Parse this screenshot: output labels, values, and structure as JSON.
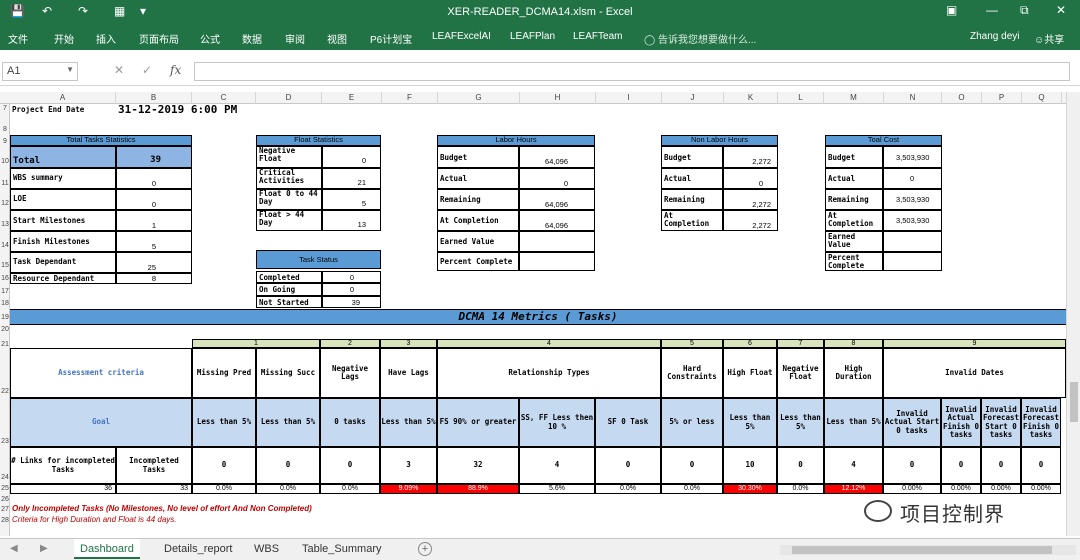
{
  "window": {
    "title": "XER-READER_DCMA14.xlsm - Excel",
    "qa_icons": [
      "save-icon",
      "undo-icon",
      "redo-icon",
      "form-icon",
      "customize-icon"
    ],
    "win_icons": [
      "ribbon-display-icon",
      "minimize-icon",
      "restore-icon",
      "close-icon"
    ]
  },
  "ribbon": {
    "tabs": [
      "文件",
      "开始",
      "插入",
      "页面布局",
      "公式",
      "数据",
      "审阅",
      "视图",
      "P6计划宝",
      "LEAFExcelAI",
      "LEAFPlan",
      "LEAFTeam"
    ],
    "tell_me": "告诉我您想要做什么...",
    "user": "Zhang deyi",
    "share": "共享"
  },
  "formula_bar": {
    "name_box": "A1",
    "cancel": "✕",
    "enter": "✓",
    "fx": "fx",
    "formula": ""
  },
  "columns": [
    "A",
    "B",
    "C",
    "D",
    "E",
    "F",
    "G",
    "H",
    "I",
    "J",
    "K",
    "L",
    "M",
    "N",
    "O",
    "P",
    "Q"
  ],
  "rows": [
    "7",
    "8",
    "9",
    "10",
    "11",
    "12",
    "13",
    "14",
    "15",
    "16",
    "17",
    "18",
    "19",
    "20",
    "21",
    "22",
    "23",
    "24",
    "25",
    "26",
    "27",
    "28"
  ],
  "project_end": {
    "label": "Project End Date",
    "value": "31-12-2019 6:00 PM"
  },
  "total_tasks": {
    "header": "Total Tasks Statistics",
    "total_label": "Total",
    "total_value": "39",
    "rows": [
      {
        "label": "WBS summary",
        "value": "0"
      },
      {
        "label": "LOE",
        "value": "0"
      },
      {
        "label": "Start Milestones",
        "value": "1"
      },
      {
        "label": "Finish Milestones",
        "value": "5"
      },
      {
        "label": "Task Dependant",
        "value": "25"
      },
      {
        "label": "Resource Dependant",
        "value": "8"
      }
    ]
  },
  "float_stats": {
    "header": "Float Statistics",
    "rows": [
      {
        "label": "Negative Float",
        "value": "0"
      },
      {
        "label": "Critical Activities",
        "value": "21"
      },
      {
        "label": "Float 0 to 44 Day",
        "value": "5"
      },
      {
        "label": "Float > 44 Day",
        "value": "13"
      }
    ]
  },
  "task_status": {
    "header": "Task Status",
    "rows": [
      {
        "label": "Completed",
        "value": "0"
      },
      {
        "label": "On Going",
        "value": "0"
      },
      {
        "label": "Not Started",
        "value": "39"
      }
    ]
  },
  "labor": {
    "header": "Labor Hours",
    "rows": [
      {
        "label": "Budget",
        "value": "64,096"
      },
      {
        "label": "Actual",
        "value": "0"
      },
      {
        "label": "Remaining",
        "value": "64,096"
      },
      {
        "label": "At Completion",
        "value": "64,096"
      },
      {
        "label": "Earned Value",
        "value": ""
      },
      {
        "label": "Percent Complete",
        "value": ""
      }
    ]
  },
  "nonlabor": {
    "header": "Non Labor Hours",
    "rows": [
      {
        "label": "Budget",
        "value": "2,272"
      },
      {
        "label": "Actual",
        "value": "0"
      },
      {
        "label": "Remaining",
        "value": "2,272"
      },
      {
        "label": "At Completion",
        "value": "2,272"
      }
    ]
  },
  "cost": {
    "header": "Toal Cost",
    "rows": [
      {
        "label": "Budget",
        "value": "3,503,930"
      },
      {
        "label": "Actual",
        "value": "0"
      },
      {
        "label": "Remaining",
        "value": "3,503,930"
      },
      {
        "label": "At Completion",
        "value": "3,503,930"
      },
      {
        "label": "Earned Value",
        "value": ""
      },
      {
        "label": "Percent Complete",
        "value": ""
      }
    ]
  },
  "dcma": {
    "title": "DCMA 14 Metrics ( Tasks)",
    "assessment_label": "Assessment criteria",
    "goal_label": "Goal",
    "links_label": "# Links for incompleted Tasks",
    "incompleted_label": "Incompleted Tasks",
    "links_value": "36",
    "incompleted_value": "33",
    "groups": [
      "1",
      "2",
      "3",
      "4",
      "5",
      "6",
      "7",
      "8",
      "9"
    ],
    "criteria": [
      "Missing Pred",
      "Missing Succ",
      "Negative Lags",
      "Have Lags",
      "Relationship Types",
      "Hard Constraints",
      "High Float",
      "Negative Float",
      "High Duration",
      "Invalid Dates"
    ],
    "goals": [
      "Less than 5%",
      "Less than 5%",
      "0 tasks",
      "Less than 5%",
      "FS 90% or greater",
      "SS, FF Less then 10 %",
      "SF 0 Task",
      "5% or less",
      "Less than 5%",
      "Less than 5%",
      "Less than 5%",
      "Invalid Actual Start 0 tasks",
      "Invalid Actual Finish 0 tasks",
      "Invalid Forecast Start 0 tasks",
      "Invalid Forecast Finish 0 tasks"
    ],
    "counts": [
      "0",
      "0",
      "0",
      "3",
      "32",
      "4",
      "0",
      "0",
      "10",
      "0",
      "4",
      "0",
      "0",
      "0",
      "0"
    ],
    "percents": [
      "0.0%",
      "0.0%",
      "0.0%",
      "9.09%",
      "88.9%",
      "5.6%",
      "0.0%",
      "0.0%",
      "30.30%",
      "0.0%",
      "12.12%",
      "0.00%",
      "0.00%",
      "0.00%",
      "0.00%"
    ],
    "fail": [
      false,
      false,
      false,
      true,
      true,
      false,
      false,
      false,
      true,
      false,
      true,
      false,
      false,
      false,
      false
    ]
  },
  "notes": {
    "line1": "Only Incompleted Tasks (No Milestones, No level of effort And Non Completed)",
    "line2": "Criteria for High Duration and Float is 44 days."
  },
  "sheet_tabs": [
    "Dashboard",
    "Details_report",
    "WBS",
    "Table_Summary"
  ],
  "active_tab": "Dashboard",
  "watermark": "项目控制界",
  "colors": {
    "excel_green": "#217346",
    "header_blue": "#5b9bd5",
    "light_blue": "#c5d9f1",
    "light_green": "#d8e4bc",
    "fail_red": "#ff0000"
  }
}
